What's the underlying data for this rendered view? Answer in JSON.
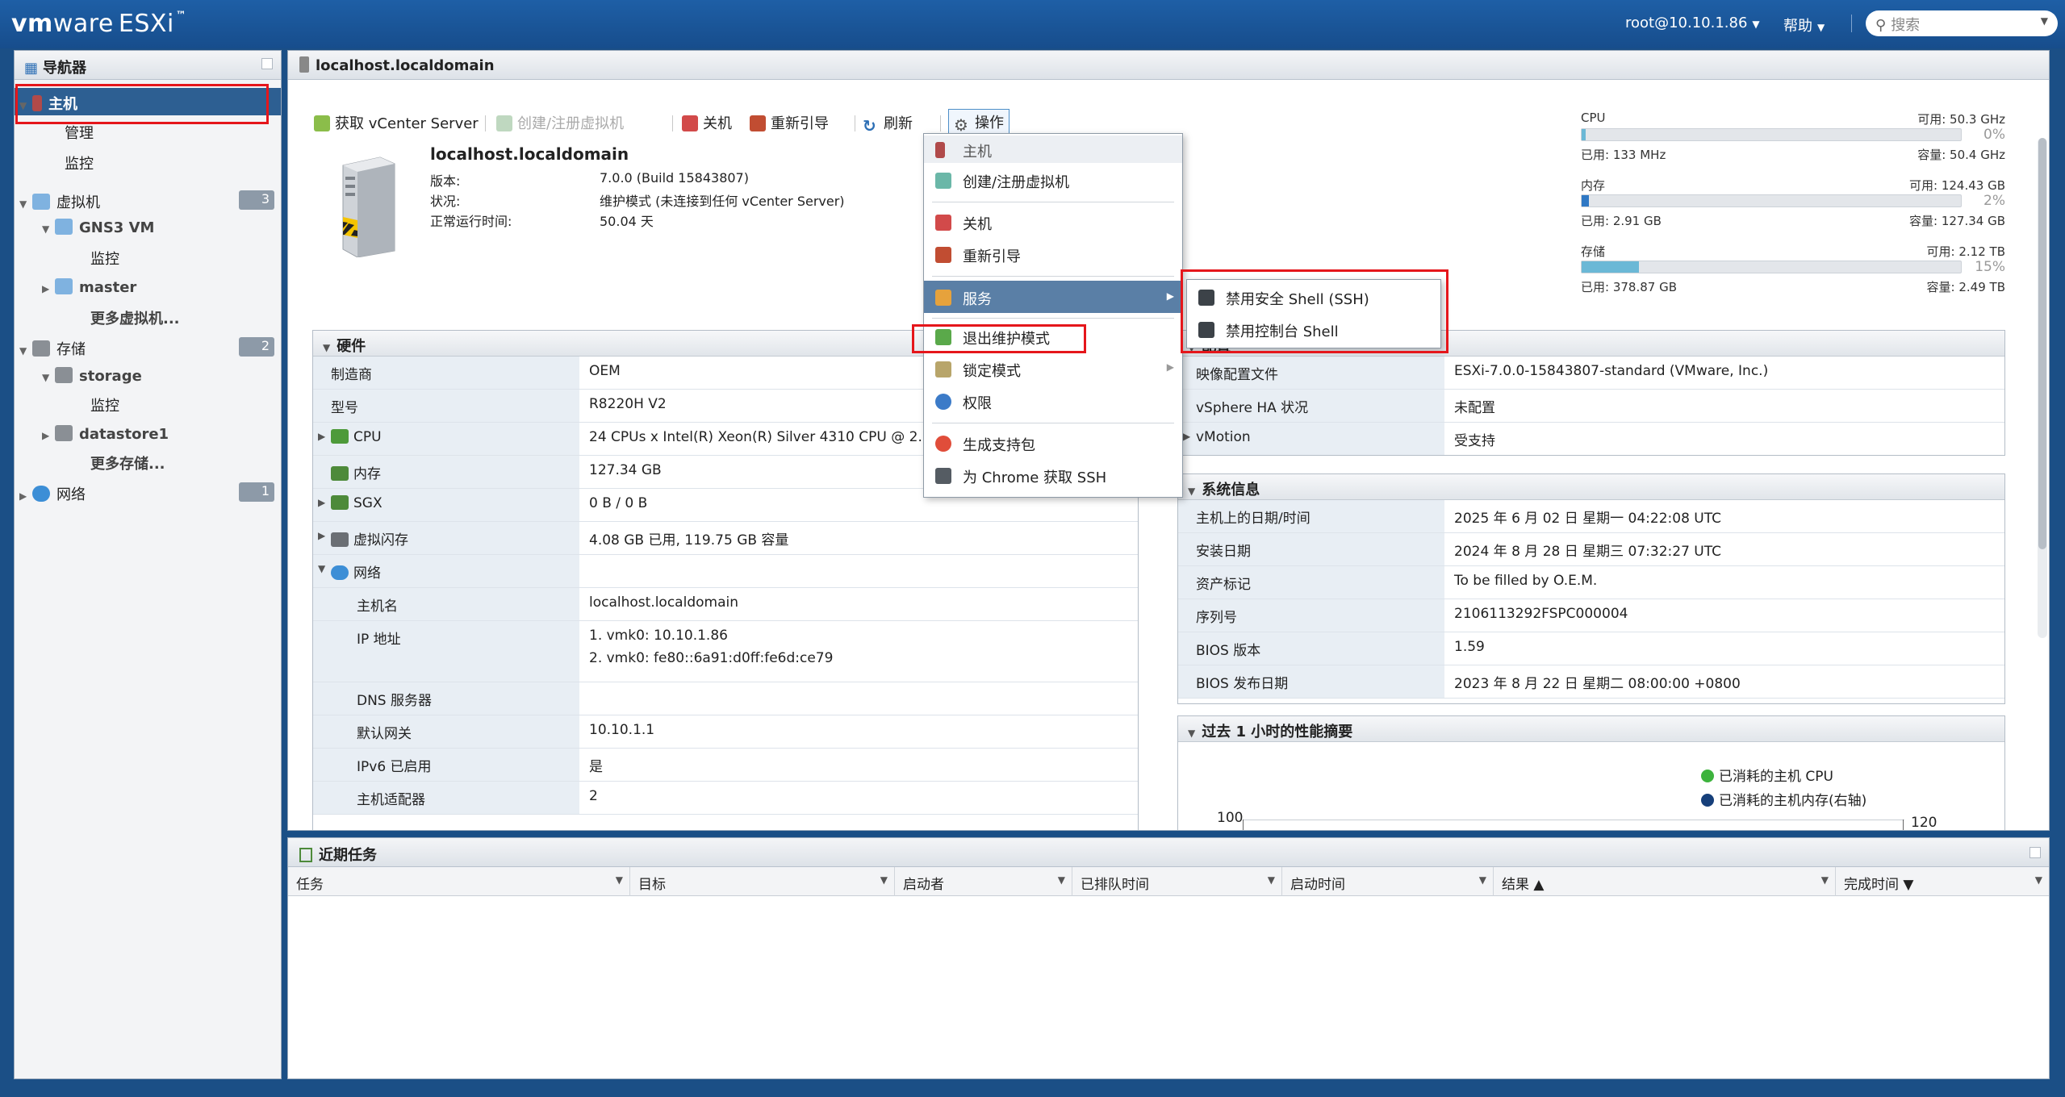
{
  "topbar": {
    "brand": "vm",
    "brand2": "ware",
    "product": "ESXi",
    "tm": "™",
    "user": "root@10.10.1.86",
    "help": "帮助",
    "search_placeholder": "搜索"
  },
  "navigator": {
    "title": "导航器",
    "items": [
      {
        "label": "主机"
      },
      {
        "label": "管理"
      },
      {
        "label": "监控"
      },
      {
        "label": "虚拟机",
        "badge": "3"
      },
      {
        "label": "GNS3 VM"
      },
      {
        "label": "监控"
      },
      {
        "label": "master"
      },
      {
        "label": "更多虚拟机..."
      },
      {
        "label": "存储",
        "badge": "2"
      },
      {
        "label": "storage"
      },
      {
        "label": "监控"
      },
      {
        "label": "datastore1"
      },
      {
        "label": "更多存储..."
      },
      {
        "label": "网络",
        "badge": "1"
      }
    ]
  },
  "main": {
    "title": "localhost.localdomain",
    "toolbar": {
      "vcenter": "获取 vCenter Server",
      "create_vm": "创建/注册虚拟机",
      "shutdown": "关机",
      "reboot": "重新引导",
      "refresh": "刷新",
      "actions": "操作"
    },
    "summary": {
      "name": "localhost.localdomain",
      "version_label": "版本:",
      "version_value": "7.0.0 (Build 15843807)",
      "state_label": "状况:",
      "state_value": "维护模式 (未连接到任何 vCenter Server)",
      "uptime_label": "正常运行时间:",
      "uptime_value": "50.04 天"
    },
    "resources": {
      "cpu": {
        "label": "CPU",
        "avail": "可用: 50.3 GHz",
        "pct": "0%",
        "pct_value": 0.3,
        "used": "已用: 133 MHz",
        "cap": "容量: 50.4 GHz"
      },
      "mem": {
        "label": "内存",
        "avail": "可用: 124.43 GB",
        "pct": "2%",
        "pct_value": 2,
        "used": "已用: 2.91 GB",
        "cap": "容量: 127.34 GB"
      },
      "storage": {
        "label": "存储",
        "avail": "可用: 2.12 TB",
        "pct": "15%",
        "pct_value": 15,
        "used": "已用: 378.87 GB",
        "cap": "容量: 2.49 TB"
      }
    },
    "hardware": {
      "title": "硬件",
      "rows": [
        {
          "k": "制造商",
          "v": "OEM"
        },
        {
          "k": "型号",
          "v": "R8220H V2"
        },
        {
          "k": "CPU",
          "v": "24 CPUs x Intel(R) Xeon(R) Silver 4310 CPU @ 2.10"
        },
        {
          "k": "内存",
          "v": "127.34 GB"
        },
        {
          "k": "SGX",
          "v": "0 B / 0 B"
        },
        {
          "k": "虚拟闪存",
          "v": "4.08 GB 已用, 119.75 GB 容量"
        },
        {
          "k": "网络",
          "v": ""
        },
        {
          "k": "主机名",
          "v": "localhost.localdomain"
        },
        {
          "k": "IP 地址",
          "v": "1. vmk0: 10.10.1.86",
          "v2": "2. vmk0: fe80::6a91:d0ff:fe6d:ce79"
        },
        {
          "k": "DNS 服务器",
          "v": ""
        },
        {
          "k": "默认网关",
          "v": "10.10.1.1"
        },
        {
          "k": "IPv6 已启用",
          "v": "是"
        },
        {
          "k": "主机适配器",
          "v": "2"
        }
      ]
    },
    "config": {
      "title": "配置",
      "rows": [
        {
          "k": "映像配置文件",
          "v": "ESXi-7.0.0-15843807-standard (VMware, Inc.)"
        },
        {
          "k": "vSphere HA 状况",
          "v": "未配置"
        },
        {
          "k": "vMotion",
          "v": "受支持"
        }
      ]
    },
    "sysinfo": {
      "title": "系统信息",
      "rows": [
        {
          "k": "主机上的日期/时间",
          "v": "2025 年 6 月 02 日 星期一 04:22:08 UTC"
        },
        {
          "k": "安装日期",
          "v": "2024 年 8 月 28 日 星期三 07:32:27 UTC"
        },
        {
          "k": "资产标记",
          "v": "To be filled by O.E.M."
        },
        {
          "k": "序列号",
          "v": "2106113292FSPC000004"
        },
        {
          "k": "BIOS 版本",
          "v": "1.59"
        },
        {
          "k": "BIOS 发布日期",
          "v": "2023 年 8 月 22 日 星期二 08:00:00 +0800"
        }
      ]
    },
    "perf": {
      "title": "过去 1 小时的性能摘要",
      "legend_cpu": "已消耗的主机 CPU",
      "legend_mem": "已消耗的主机内存(右轴)",
      "y_left_top": "100",
      "y_right_top": "120",
      "colors": {
        "cpu": "#3db33d",
        "mem": "#163f7a"
      }
    }
  },
  "context_menu": {
    "header": "主机",
    "items": [
      {
        "label": "创建/注册虚拟机"
      },
      {
        "label": "关机"
      },
      {
        "label": "重新引导"
      },
      {
        "label": "服务"
      },
      {
        "label": "退出维护模式"
      },
      {
        "label": "锁定模式"
      },
      {
        "label": "权限"
      },
      {
        "label": "生成支持包"
      },
      {
        "label": "为 Chrome 获取 SSH"
      }
    ]
  },
  "submenu": {
    "items": [
      {
        "label": "禁用安全 Shell (SSH)"
      },
      {
        "label": "禁用控制台 Shell"
      }
    ]
  },
  "tasks": {
    "title": "近期任务",
    "columns": [
      "任务",
      "目标",
      "启动者",
      "已排队时间",
      "启动时间",
      "结果 ▲",
      "完成时间 ▼"
    ]
  },
  "colors": {
    "topbar": "#1e5fa6",
    "selection": "#2d5f92",
    "highlight_box": "#e5161b"
  }
}
